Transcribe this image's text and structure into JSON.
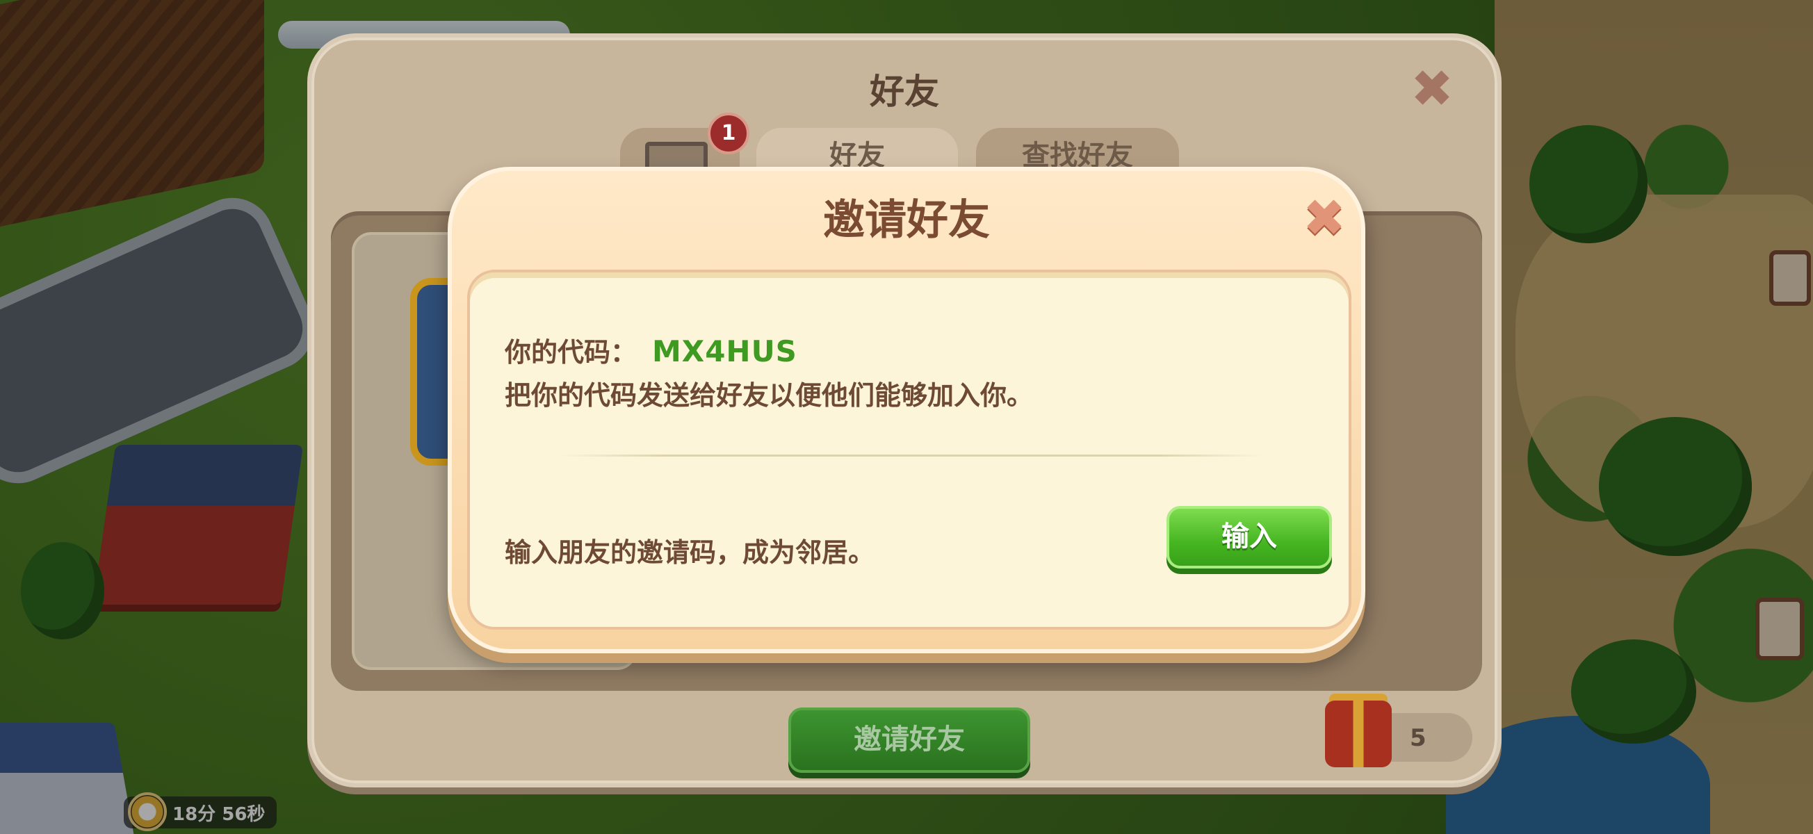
{
  "friends_panel": {
    "title": "好友",
    "close_glyph": "✖",
    "tabs": [
      {
        "label": "",
        "icon": "mail-icon",
        "badge": "1"
      },
      {
        "label": "好友"
      },
      {
        "label": "查找好友"
      }
    ],
    "invite_button_label": "邀请好友",
    "gift_count": "5"
  },
  "invite_dialog": {
    "title": "邀请好友",
    "close_glyph": "✖",
    "code_label": "你的代码：",
    "code_value": "MX4HUS",
    "share_text": "把你的代码发送给好友以便他们能够加入你。",
    "enter_prompt": "输入朋友的邀请码，成为邻居。",
    "enter_button_label": "输入"
  },
  "hud": {
    "timer_text": "18分 56秒"
  },
  "colors": {
    "code_green": "#3f9a22",
    "button_green": "#46b521",
    "dialog_bg": "#fcf5d9",
    "text_brown": "#6e4a35"
  }
}
